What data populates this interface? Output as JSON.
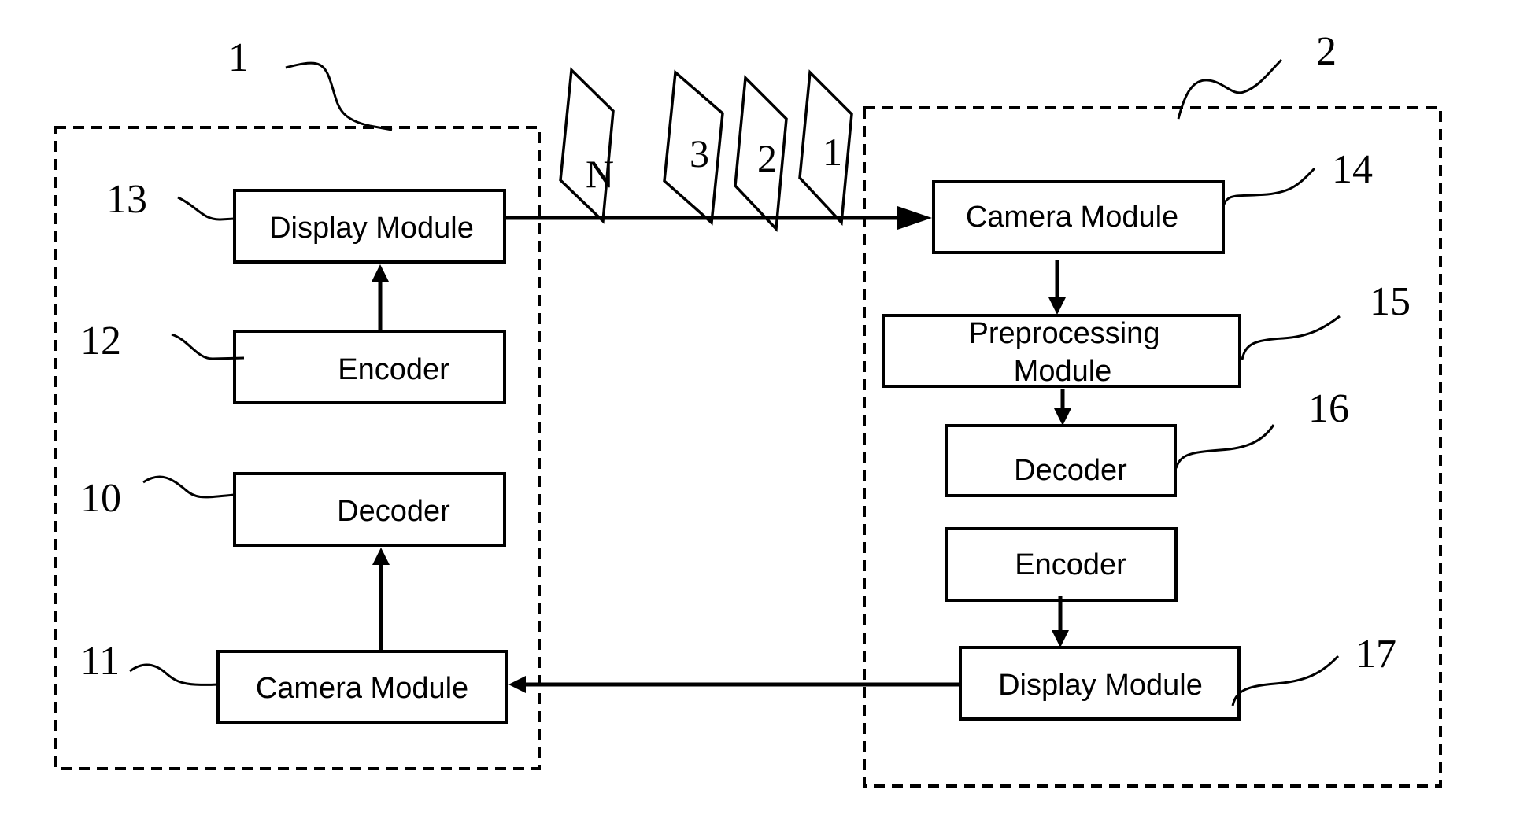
{
  "figure": {
    "device1": {
      "ref": "1",
      "modules": [
        {
          "ref": "13",
          "label": "Display Module"
        },
        {
          "ref": "12",
          "label": "Encoder"
        },
        {
          "ref": "10",
          "label": "Decoder"
        },
        {
          "ref": "11",
          "label": "Camera Module"
        }
      ]
    },
    "device2": {
      "ref": "2",
      "modules": [
        {
          "ref": "14",
          "label": "Camera Module"
        },
        {
          "ref": "15",
          "label_line1": "Preprocessing",
          "label_line2": "Module"
        },
        {
          "ref": "16",
          "label": "Decoder"
        },
        {
          "ref": "",
          "label": "Encoder"
        },
        {
          "ref": "17",
          "label": "Display Module"
        }
      ]
    },
    "frames": [
      "N",
      "3",
      "2",
      "1"
    ]
  }
}
